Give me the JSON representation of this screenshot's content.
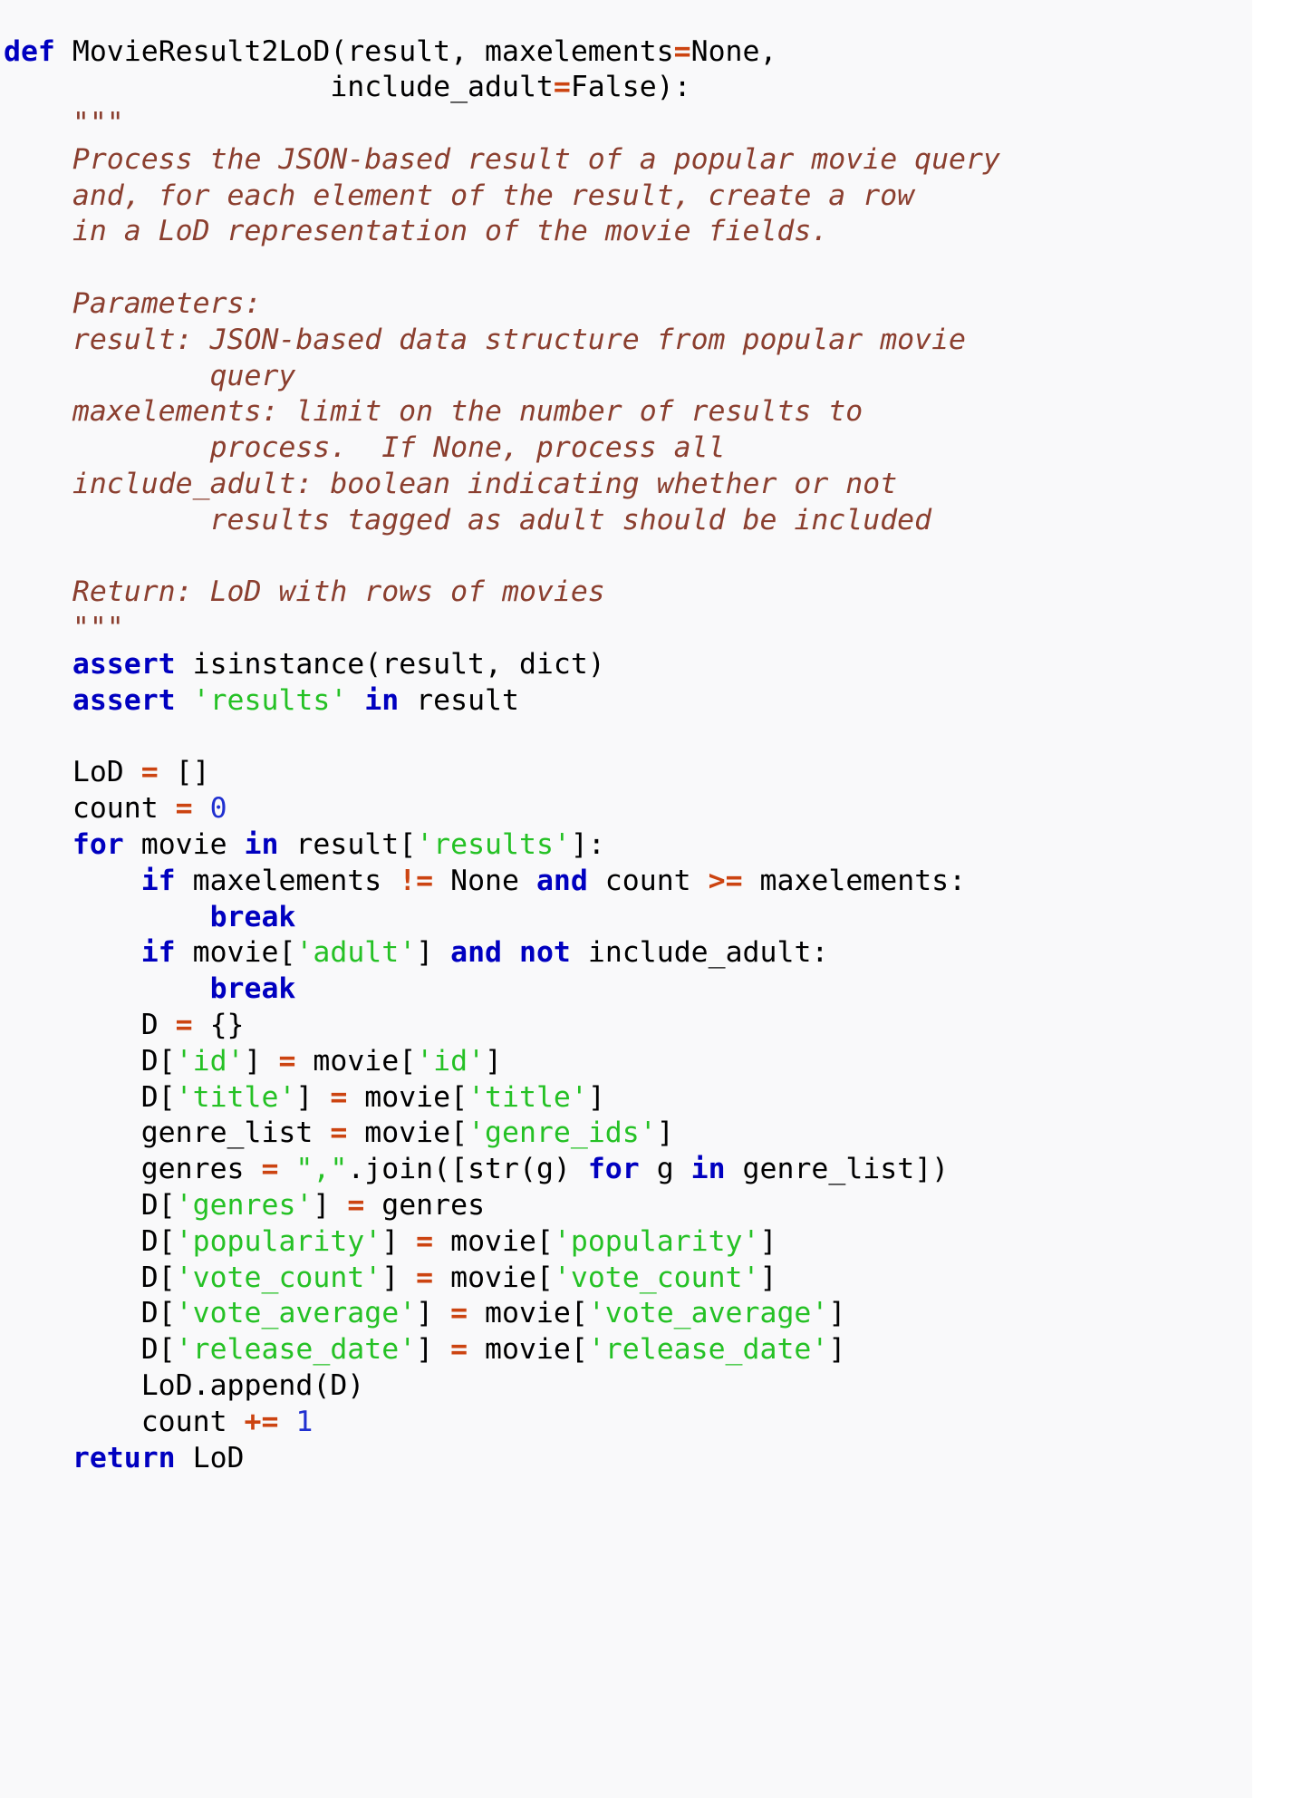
{
  "figure": {
    "kind": "source-code-listing",
    "language": "Python",
    "function_name": "MovieResult2LoD",
    "background_color": "#f9f9fa",
    "page_background_color": "#ffffff"
  },
  "theme": {
    "keyword_color": "#0000c0",
    "string_color": "#25c125",
    "operator_color": "#cc4411",
    "number_color": "#2030d0",
    "comment_color": "#8b3f2f",
    "text_color": "#000000"
  },
  "code": {
    "lines": [
      [
        {
          "t": "k",
          "v": "def"
        },
        {
          "t": "n",
          "v": " MovieResult2LoD(result, maxelements"
        },
        {
          "t": "o",
          "v": "="
        },
        {
          "t": "n",
          "v": "None,"
        }
      ],
      [
        {
          "t": "n",
          "v": "                   include_adult"
        },
        {
          "t": "o",
          "v": "="
        },
        {
          "t": "n",
          "v": "False):"
        }
      ],
      [
        {
          "t": "c",
          "v": "    \"\"\""
        }
      ],
      [
        {
          "t": "c",
          "v": "    Process the JSON-based result of a popular movie query"
        }
      ],
      [
        {
          "t": "c",
          "v": "    and, for each element of the result, create a row"
        }
      ],
      [
        {
          "t": "c",
          "v": "    in a LoD representation of the movie fields."
        }
      ],
      [
        {
          "t": "c",
          "v": ""
        }
      ],
      [
        {
          "t": "c",
          "v": "    Parameters:"
        }
      ],
      [
        {
          "t": "c",
          "v": "    result: JSON-based data structure from popular movie"
        }
      ],
      [
        {
          "t": "c",
          "v": "            query"
        }
      ],
      [
        {
          "t": "c",
          "v": "    maxelements: limit on the number of results to"
        }
      ],
      [
        {
          "t": "c",
          "v": "            process.  If None, process all"
        }
      ],
      [
        {
          "t": "c",
          "v": "    include_adult: boolean indicating whether or not"
        }
      ],
      [
        {
          "t": "c",
          "v": "            results tagged as adult should be included"
        }
      ],
      [
        {
          "t": "c",
          "v": ""
        }
      ],
      [
        {
          "t": "c",
          "v": "    Return: LoD with rows of movies"
        }
      ],
      [
        {
          "t": "c",
          "v": "    \"\"\""
        }
      ],
      [
        {
          "t": "n",
          "v": "    "
        },
        {
          "t": "k",
          "v": "assert"
        },
        {
          "t": "n",
          "v": " isinstance(result, dict)"
        }
      ],
      [
        {
          "t": "n",
          "v": "    "
        },
        {
          "t": "k",
          "v": "assert"
        },
        {
          "t": "n",
          "v": " "
        },
        {
          "t": "s",
          "v": "'results'"
        },
        {
          "t": "n",
          "v": " "
        },
        {
          "t": "k",
          "v": "in"
        },
        {
          "t": "n",
          "v": " result"
        }
      ],
      [
        {
          "t": "n",
          "v": ""
        }
      ],
      [
        {
          "t": "n",
          "v": "    LoD "
        },
        {
          "t": "o",
          "v": "="
        },
        {
          "t": "n",
          "v": " []"
        }
      ],
      [
        {
          "t": "n",
          "v": "    count "
        },
        {
          "t": "o",
          "v": "="
        },
        {
          "t": "n",
          "v": " "
        },
        {
          "t": "m",
          "v": "0"
        }
      ],
      [
        {
          "t": "n",
          "v": "    "
        },
        {
          "t": "k",
          "v": "for"
        },
        {
          "t": "n",
          "v": " movie "
        },
        {
          "t": "k",
          "v": "in"
        },
        {
          "t": "n",
          "v": " result["
        },
        {
          "t": "s",
          "v": "'results'"
        },
        {
          "t": "n",
          "v": "]:"
        }
      ],
      [
        {
          "t": "n",
          "v": "        "
        },
        {
          "t": "k",
          "v": "if"
        },
        {
          "t": "n",
          "v": " maxelements "
        },
        {
          "t": "o",
          "v": "!="
        },
        {
          "t": "n",
          "v": " None "
        },
        {
          "t": "k",
          "v": "and"
        },
        {
          "t": "n",
          "v": " count "
        },
        {
          "t": "o",
          "v": ">="
        },
        {
          "t": "n",
          "v": " maxelements:"
        }
      ],
      [
        {
          "t": "n",
          "v": "            "
        },
        {
          "t": "k",
          "v": "break"
        }
      ],
      [
        {
          "t": "n",
          "v": "        "
        },
        {
          "t": "k",
          "v": "if"
        },
        {
          "t": "n",
          "v": " movie["
        },
        {
          "t": "s",
          "v": "'adult'"
        },
        {
          "t": "n",
          "v": "] "
        },
        {
          "t": "k",
          "v": "and"
        },
        {
          "t": "n",
          "v": " "
        },
        {
          "t": "k",
          "v": "not"
        },
        {
          "t": "n",
          "v": " include_adult:"
        }
      ],
      [
        {
          "t": "n",
          "v": "            "
        },
        {
          "t": "k",
          "v": "break"
        }
      ],
      [
        {
          "t": "n",
          "v": "        D "
        },
        {
          "t": "o",
          "v": "="
        },
        {
          "t": "n",
          "v": " {}"
        }
      ],
      [
        {
          "t": "n",
          "v": "        D["
        },
        {
          "t": "s",
          "v": "'id'"
        },
        {
          "t": "n",
          "v": "] "
        },
        {
          "t": "o",
          "v": "="
        },
        {
          "t": "n",
          "v": " movie["
        },
        {
          "t": "s",
          "v": "'id'"
        },
        {
          "t": "n",
          "v": "]"
        }
      ],
      [
        {
          "t": "n",
          "v": "        D["
        },
        {
          "t": "s",
          "v": "'title'"
        },
        {
          "t": "n",
          "v": "] "
        },
        {
          "t": "o",
          "v": "="
        },
        {
          "t": "n",
          "v": " movie["
        },
        {
          "t": "s",
          "v": "'title'"
        },
        {
          "t": "n",
          "v": "]"
        }
      ],
      [
        {
          "t": "n",
          "v": "        genre_list "
        },
        {
          "t": "o",
          "v": "="
        },
        {
          "t": "n",
          "v": " movie["
        },
        {
          "t": "s",
          "v": "'genre_ids'"
        },
        {
          "t": "n",
          "v": "]"
        }
      ],
      [
        {
          "t": "n",
          "v": "        genres "
        },
        {
          "t": "o",
          "v": "="
        },
        {
          "t": "n",
          "v": " "
        },
        {
          "t": "s",
          "v": "\",\""
        },
        {
          "t": "n",
          "v": ".join([str(g) "
        },
        {
          "t": "k",
          "v": "for"
        },
        {
          "t": "n",
          "v": " g "
        },
        {
          "t": "k",
          "v": "in"
        },
        {
          "t": "n",
          "v": " genre_list])"
        }
      ],
      [
        {
          "t": "n",
          "v": "        D["
        },
        {
          "t": "s",
          "v": "'genres'"
        },
        {
          "t": "n",
          "v": "] "
        },
        {
          "t": "o",
          "v": "="
        },
        {
          "t": "n",
          "v": " genres"
        }
      ],
      [
        {
          "t": "n",
          "v": "        D["
        },
        {
          "t": "s",
          "v": "'popularity'"
        },
        {
          "t": "n",
          "v": "] "
        },
        {
          "t": "o",
          "v": "="
        },
        {
          "t": "n",
          "v": " movie["
        },
        {
          "t": "s",
          "v": "'popularity'"
        },
        {
          "t": "n",
          "v": "]"
        }
      ],
      [
        {
          "t": "n",
          "v": "        D["
        },
        {
          "t": "s",
          "v": "'vote_count'"
        },
        {
          "t": "n",
          "v": "] "
        },
        {
          "t": "o",
          "v": "="
        },
        {
          "t": "n",
          "v": " movie["
        },
        {
          "t": "s",
          "v": "'vote_count'"
        },
        {
          "t": "n",
          "v": "]"
        }
      ],
      [
        {
          "t": "n",
          "v": "        D["
        },
        {
          "t": "s",
          "v": "'vote_average'"
        },
        {
          "t": "n",
          "v": "] "
        },
        {
          "t": "o",
          "v": "="
        },
        {
          "t": "n",
          "v": " movie["
        },
        {
          "t": "s",
          "v": "'vote_average'"
        },
        {
          "t": "n",
          "v": "]"
        }
      ],
      [
        {
          "t": "n",
          "v": "        D["
        },
        {
          "t": "s",
          "v": "'release_date'"
        },
        {
          "t": "n",
          "v": "] "
        },
        {
          "t": "o",
          "v": "="
        },
        {
          "t": "n",
          "v": " movie["
        },
        {
          "t": "s",
          "v": "'release_date'"
        },
        {
          "t": "n",
          "v": "]"
        }
      ],
      [
        {
          "t": "n",
          "v": "        LoD.append(D)"
        }
      ],
      [
        {
          "t": "n",
          "v": "        count "
        },
        {
          "t": "o",
          "v": "+="
        },
        {
          "t": "n",
          "v": " "
        },
        {
          "t": "m",
          "v": "1"
        }
      ],
      [
        {
          "t": "n",
          "v": "    "
        },
        {
          "t": "k",
          "v": "return"
        },
        {
          "t": "n",
          "v": " LoD"
        }
      ]
    ]
  }
}
